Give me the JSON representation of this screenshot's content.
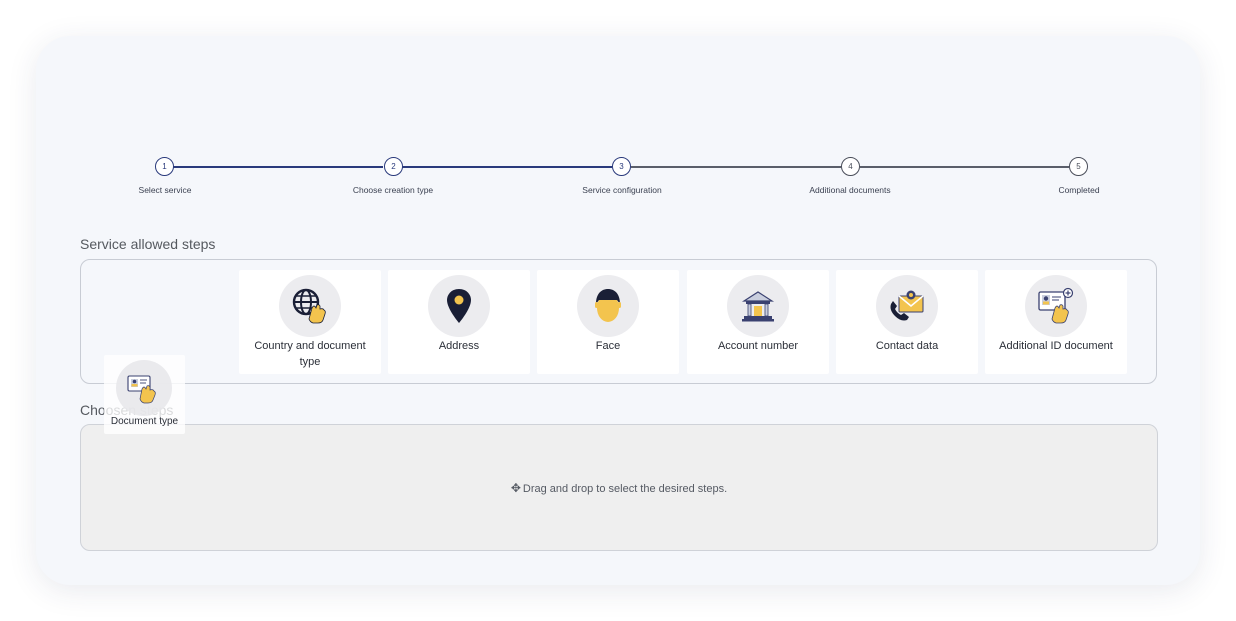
{
  "stepper": {
    "steps": [
      {
        "number": "1",
        "label": "Select service"
      },
      {
        "number": "2",
        "label": "Choose creation type"
      },
      {
        "number": "3",
        "label": "Service configuration"
      },
      {
        "number": "4",
        "label": "Additional documents"
      },
      {
        "number": "5",
        "label": "Completed"
      }
    ]
  },
  "allowed": {
    "title": "Service allowed steps",
    "cards": [
      {
        "label": "Country and document type",
        "icon": "globe-hand-icon"
      },
      {
        "label": "Address",
        "icon": "map-pin-icon"
      },
      {
        "label": "Face",
        "icon": "face-icon"
      },
      {
        "label": "Account number",
        "icon": "bank-icon"
      },
      {
        "label": "Contact data",
        "icon": "phone-envelope-icon"
      },
      {
        "label": "Additional ID document",
        "icon": "id-card-add-icon"
      }
    ]
  },
  "chosen": {
    "title": "Choosen steps",
    "hint": "Drag and drop to select the desired steps."
  },
  "drag_ghost": {
    "label": "Document type",
    "icon": "id-card-hand-icon"
  },
  "colors": {
    "active": "#2a3a7c",
    "inactive": "#5a5e6a",
    "accent_yellow": "#f3c44e",
    "icon_dark": "#1a1f36"
  }
}
